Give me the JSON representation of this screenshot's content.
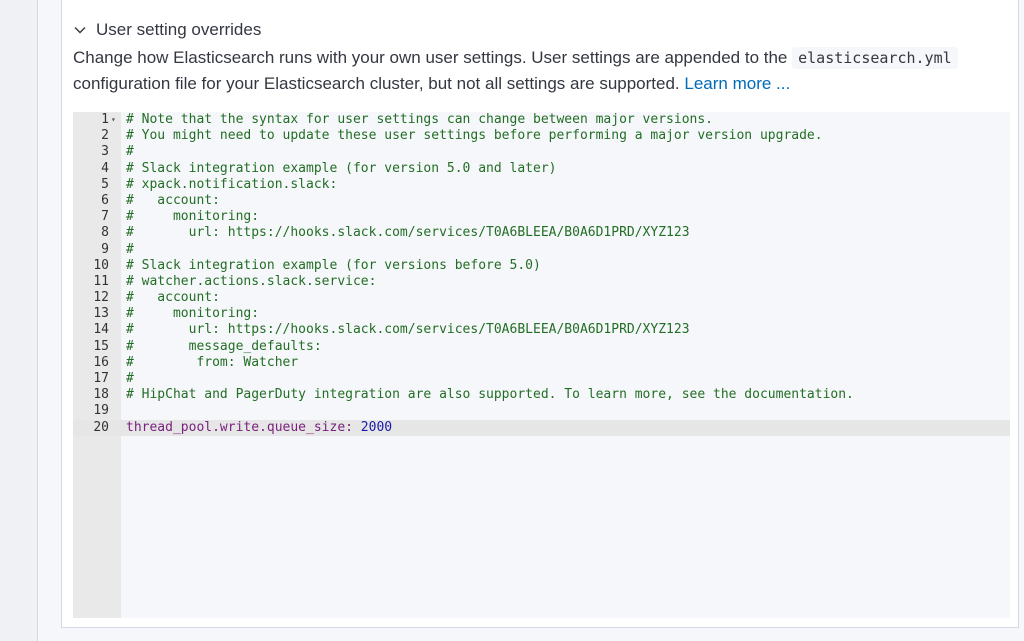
{
  "section": {
    "title": "User setting overrides",
    "icon": "chevron-down-icon"
  },
  "description": {
    "text_before": "Change how Elasticsearch runs with your own user settings. User settings are appended to the ",
    "code": "elasticsearch.yml",
    "text_after": " configuration file for your Elasticsearch cluster, but not all settings are supported. ",
    "link": "Learn more ..."
  },
  "editor": {
    "active_line": 20,
    "lines": [
      {
        "n": "1",
        "text": "# Note that the syntax for user settings can change between major versions."
      },
      {
        "n": "2",
        "text": "# You might need to update these user settings before performing a major version upgrade."
      },
      {
        "n": "3",
        "text": "#"
      },
      {
        "n": "4",
        "text": "# Slack integration example (for version 5.0 and later)"
      },
      {
        "n": "5",
        "text": "# xpack.notification.slack:"
      },
      {
        "n": "6",
        "text": "#   account:"
      },
      {
        "n": "7",
        "text": "#     monitoring:"
      },
      {
        "n": "8",
        "text": "#       url: https://hooks.slack.com/services/T0A6BLEEA/B0A6D1PRD/XYZ123"
      },
      {
        "n": "9",
        "text": "#"
      },
      {
        "n": "10",
        "text": "# Slack integration example (for versions before 5.0)"
      },
      {
        "n": "11",
        "text": "# watcher.actions.slack.service:"
      },
      {
        "n": "12",
        "text": "#   account:"
      },
      {
        "n": "13",
        "text": "#     monitoring:"
      },
      {
        "n": "14",
        "text": "#       url: https://hooks.slack.com/services/T0A6BLEEA/B0A6D1PRD/XYZ123"
      },
      {
        "n": "15",
        "text": "#       message_defaults:"
      },
      {
        "n": "16",
        "text": "#        from: Watcher"
      },
      {
        "n": "17",
        "text": "#"
      },
      {
        "n": "18",
        "text": "# HipChat and PagerDuty integration are also supported. To learn more, see the documentation."
      },
      {
        "n": "19",
        "text": ""
      },
      {
        "n": "20",
        "key": "thread_pool.write.queue_size:",
        "value": " 2000"
      }
    ]
  },
  "colors": {
    "comment": "#236e25",
    "key": "#7a1f7d",
    "number": "#1a1aa6",
    "link": "#006bb8"
  }
}
